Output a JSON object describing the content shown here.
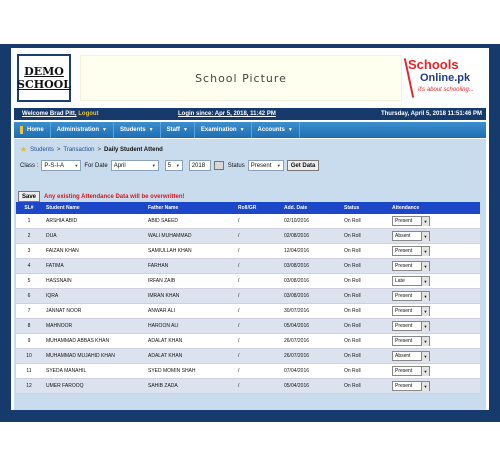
{
  "banner": {
    "logo_line1": "DEMO",
    "logo_line2": "SCHOOL",
    "picture_text": "School Picture",
    "brand_line1": "Schools",
    "brand_line2": "Online.pk",
    "brand_tagline": "it's about schooling..."
  },
  "statusbar": {
    "welcome": "Welcome Brad Pitt,",
    "logout": "Logout",
    "login_since": "Login since: Apr 5, 2018, 11:42 PM",
    "datetime": "Thursday, April 5, 2018 11:51:46 PM"
  },
  "menu": {
    "items": [
      "Home",
      "Administration",
      "Students",
      "Staff",
      "Examination",
      "Accounts"
    ]
  },
  "breadcrumb": {
    "item1": "Students",
    "item2": "Transaction",
    "current": "Daily Student Attend"
  },
  "filters": {
    "class_label": "Class :",
    "class_value": "P-S-I-A",
    "date_label": "For Date",
    "month": "April",
    "day": "5",
    "year": "2018",
    "status_label": "Status",
    "status_value": "Present",
    "get_data": "Get Data"
  },
  "actions": {
    "save": "Save",
    "warning": "Any existing Attendance Data will be overwritten!"
  },
  "table": {
    "headers": [
      "SL#",
      "Student Name",
      "Father Name",
      "Roll/GR",
      "Add. Date",
      "Status",
      "Attendance"
    ],
    "rows": [
      {
        "sl": "1",
        "name": "ARSHIA ABID",
        "father": "ABID SAEED",
        "roll": "/",
        "date": "02/10/2016",
        "status": "On Roll",
        "att": "Present"
      },
      {
        "sl": "2",
        "name": "DUA",
        "father": "WALI MUHAMMAD",
        "roll": "/",
        "date": "02/08/2016",
        "status": "On Roll",
        "att": "Absent"
      },
      {
        "sl": "3",
        "name": "FAIZAN KHAN",
        "father": "SAMIULLAH KHAN",
        "roll": "/",
        "date": "12/04/2016",
        "status": "On Roll",
        "att": "Present"
      },
      {
        "sl": "4",
        "name": "FATIMA",
        "father": "FARHAN",
        "roll": "/",
        "date": "03/08/2016",
        "status": "On Roll",
        "att": "Present"
      },
      {
        "sl": "5",
        "name": "HASSNAIN",
        "father": "IRFAN ZAIB",
        "roll": "/",
        "date": "03/08/2016",
        "status": "On Roll",
        "att": "Late"
      },
      {
        "sl": "6",
        "name": "IQRA",
        "father": "IMRAN KHAN",
        "roll": "/",
        "date": "03/08/2016",
        "status": "On Roll",
        "att": "Present"
      },
      {
        "sl": "7",
        "name": "JANNAT NOOR",
        "father": "ANWAR ALI",
        "roll": "/",
        "date": "30/07/2016",
        "status": "On Roll",
        "att": "Present"
      },
      {
        "sl": "8",
        "name": "MAHNOOR",
        "father": "HAROON ALI",
        "roll": "/",
        "date": "05/04/2016",
        "status": "On Roll",
        "att": "Present"
      },
      {
        "sl": "9",
        "name": "MUHAMMAD ABBAS KHAN",
        "father": "ADALAT KHAN",
        "roll": "/",
        "date": "26/07/2016",
        "status": "On Roll",
        "att": "Present"
      },
      {
        "sl": "10",
        "name": "MUHAMMAD MUJAHID KHAN",
        "father": "ADALAT KHAN",
        "roll": "/",
        "date": "26/07/2016",
        "status": "On Roll",
        "att": "Absent"
      },
      {
        "sl": "11",
        "name": "SYEDA MANAHIL",
        "father": "SYED MOMIN SHAH",
        "roll": "/",
        "date": "07/04/2016",
        "status": "On Roll",
        "att": "Present"
      },
      {
        "sl": "12",
        "name": "UMER FAROOQ",
        "father": "SAHIB ZADA",
        "roll": "/",
        "date": "05/04/2016",
        "status": "On Roll",
        "att": "Present"
      }
    ]
  }
}
